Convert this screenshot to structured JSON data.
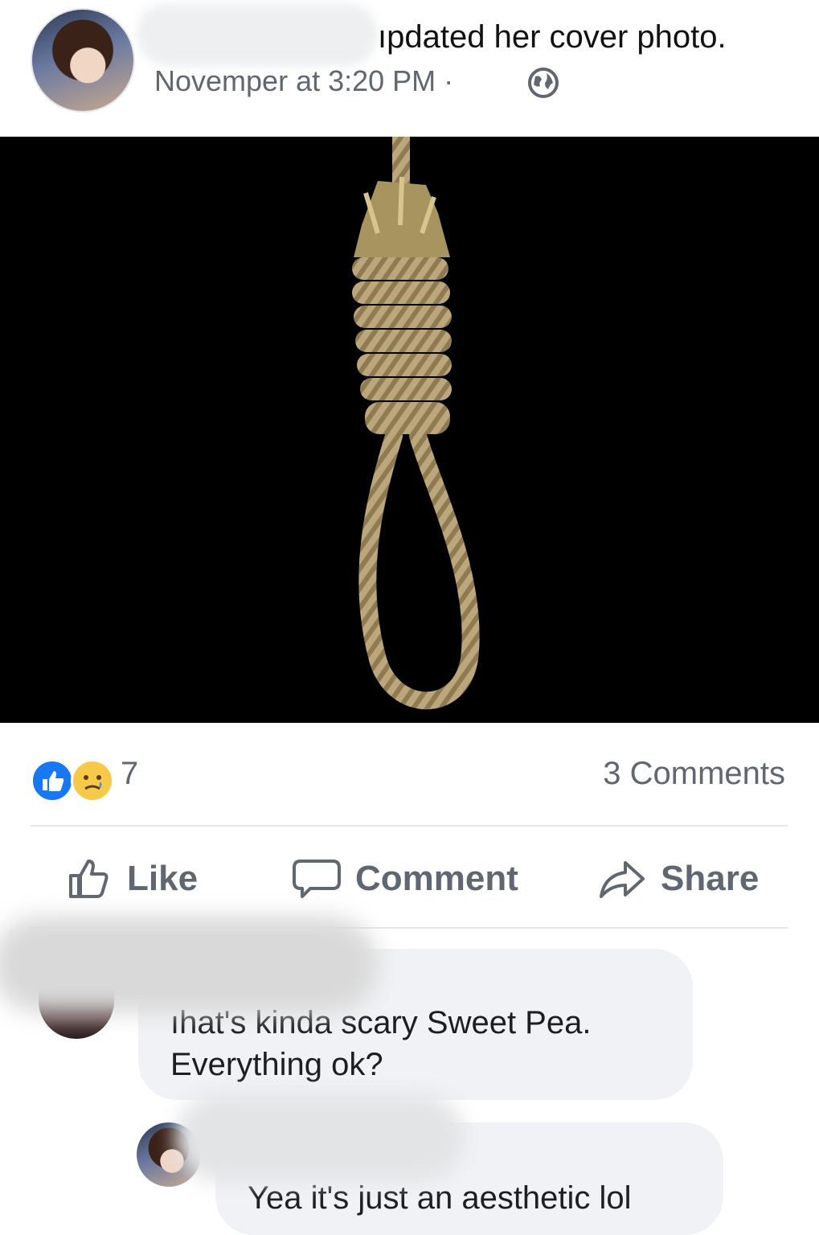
{
  "post": {
    "action_text": "ıpdated her cover photo.",
    "timestamp": "Novemper  at 3:20 PM ·",
    "privacy_icon": "globe-icon"
  },
  "stats": {
    "reaction_icons": [
      "like-reaction-icon",
      "sad-reaction-icon"
    ],
    "reaction_count": "7",
    "comments_count": "3 Comments"
  },
  "actions": {
    "like": "Like",
    "comment": "Comment",
    "share": "Share"
  },
  "comments": [
    {
      "text": "ıhat's kinda scary Sweet Pea. Everything ok?"
    },
    {
      "text": "Yea it's just an aesthetic lol"
    }
  ],
  "colors": {
    "accent": "#1877f2",
    "muted_text": "#606770",
    "bubble": "#f0f2f5",
    "divider": "#e4e6eb"
  }
}
